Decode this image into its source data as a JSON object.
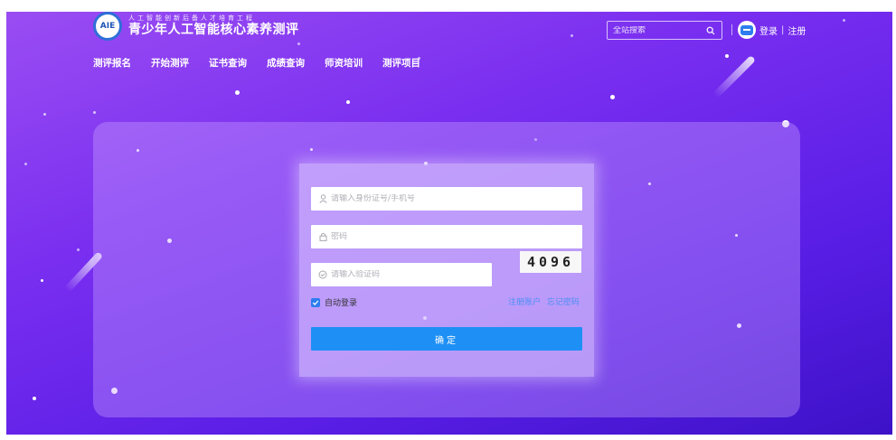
{
  "header": {
    "logo_badge": "AIE",
    "logo_small": "人工智能创新后备人才培育工程",
    "logo_title": "青少年人工智能核心素养测评",
    "nav": [
      "测评报名",
      "开始测评",
      "证书查询",
      "成绩查询",
      "师资培训",
      "测评项目"
    ],
    "search_placeholder": "全站搜索",
    "login": "登录",
    "separator": "|",
    "register": "注册"
  },
  "login_form": {
    "id_placeholder": "请输入身份证号/手机号",
    "password_placeholder": "密码",
    "captcha_placeholder": "请输入验证码",
    "captcha_value": "4096",
    "remember_label": "自动登录",
    "remember_checked": true,
    "register_link": "注册账户",
    "forgot_link": "忘记密码",
    "submit_label": "确定"
  },
  "colors": {
    "background_start": "#9a4df2",
    "background_end": "#3d12c8",
    "accent": "#1e90f5",
    "link": "#4a8ff5"
  }
}
